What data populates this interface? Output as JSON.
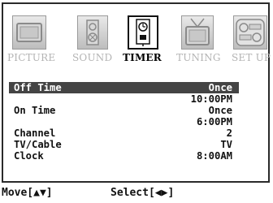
{
  "tabs": [
    {
      "label": "PICTURE",
      "icon": "picture-icon"
    },
    {
      "label": "SOUND",
      "icon": "speaker-icon"
    },
    {
      "label": "TIMER",
      "icon": "timer-icon",
      "active": true
    },
    {
      "label": "TUNING",
      "icon": "tv-antenna-icon"
    },
    {
      "label": "SET UP",
      "icon": "setup-icon"
    }
  ],
  "settings": [
    {
      "label": "Off Time",
      "value": "Once",
      "selected": true
    },
    {
      "label": "",
      "value": "10:00PM"
    },
    {
      "label": "On Time",
      "value": "Once"
    },
    {
      "label": "",
      "value": "6:00PM"
    },
    {
      "label": "Channel",
      "value": "2"
    },
    {
      "label": "TV/Cable",
      "value": "TV"
    },
    {
      "label": "Clock",
      "value": "8:00AM"
    }
  ],
  "footer": {
    "move_hint": "Move[▲▼]",
    "select_hint": "Select[◀▶]"
  },
  "colors": {
    "selected_row_bg": "#444444",
    "inactive_tab_text": "#b4b4b4"
  }
}
